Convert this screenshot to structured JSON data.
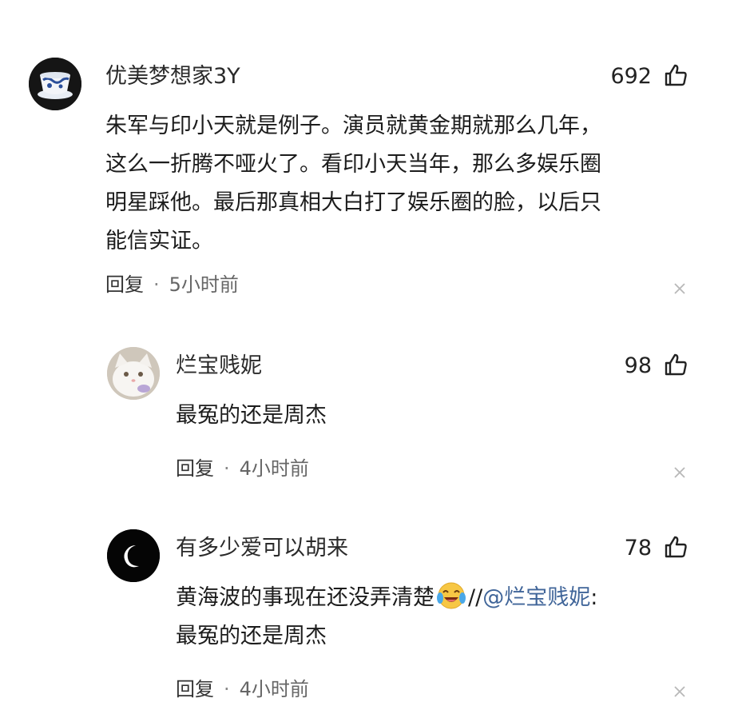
{
  "comments": [
    {
      "username": "优美梦想家3Y",
      "likes": "692",
      "lines": [
        "朱军与印小天就是例子。演员就黄金期就那么几年，",
        "这么一折腾不哑火了。看印小天当年，那么多娱乐圈",
        "明星踩他。最后那真相大白打了娱乐圈的脸，以后只",
        "能信实证。"
      ],
      "reply_label": "回复",
      "separator": "·",
      "time": "5小时前"
    },
    {
      "username": "烂宝贱妮",
      "likes": "98",
      "lines": [
        "最冤的还是周杰"
      ],
      "reply_label": "回复",
      "separator": "·",
      "time": "4小时前"
    },
    {
      "username": "有多少爱可以胡来",
      "likes": "78",
      "line1_text": "黄海波的事现在还没弄清楚",
      "line1_emoji": "laughing-crying-emoji",
      "line1_suffix": "//",
      "mention": "@烂宝贱妮",
      "mention_colon": ":",
      "line2": "最冤的还是周杰",
      "reply_label": "回复",
      "separator": "·",
      "time": "4小时前"
    }
  ],
  "colors": {
    "mention": "#406599",
    "text": "#1c1c1c",
    "meta": "#666666"
  },
  "icons": {
    "like": "thumbs-up-icon",
    "close": "close-icon"
  }
}
